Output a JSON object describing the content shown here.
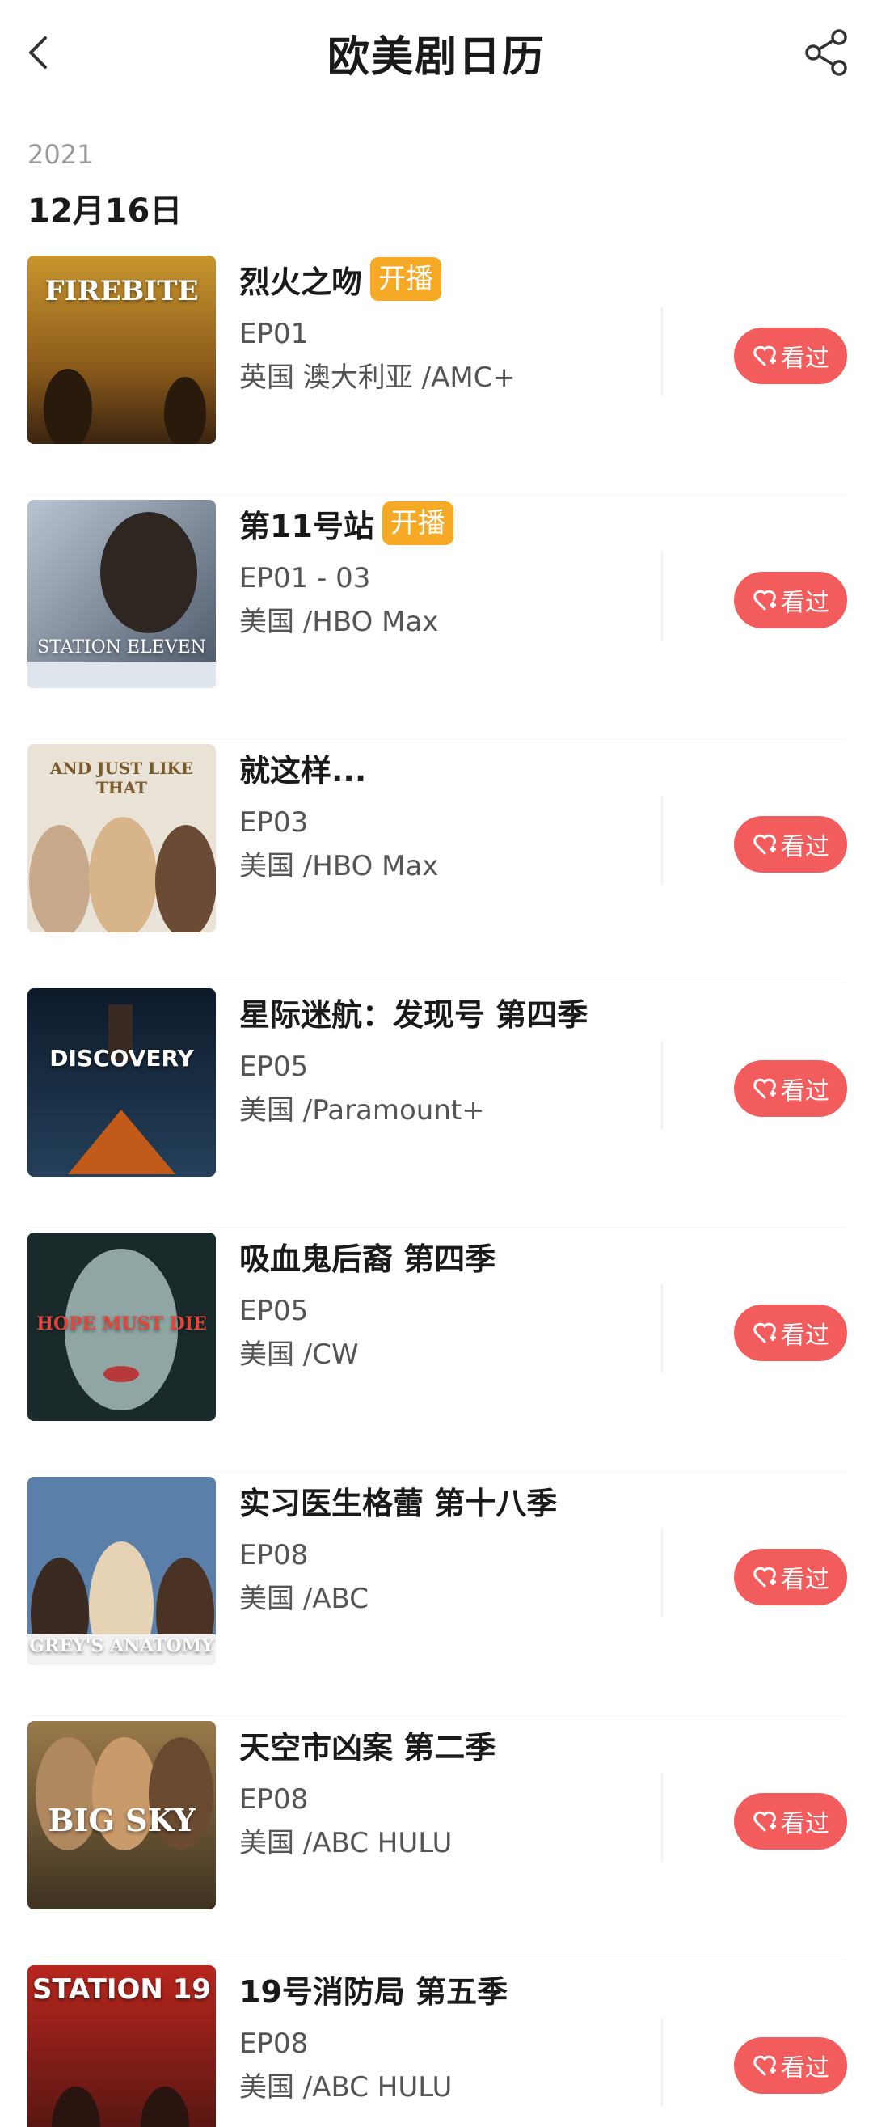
{
  "header": {
    "title": "欧美剧日历",
    "back_icon": "chevron-left-icon",
    "share_icon": "share-icon"
  },
  "section": {
    "year": "2021",
    "date": "12月16日"
  },
  "colors": {
    "badge": "#f6a924",
    "watched_button": "#f25c5c"
  },
  "shows": [
    {
      "name": "烈火之吻",
      "badge": "开播",
      "episode": "EP01",
      "region": "英国 澳大利亚 /AMC+",
      "poster_text": "FIREBITE",
      "action": "看过"
    },
    {
      "name": "第11号站",
      "badge": "开播",
      "episode": "EP01 - 03",
      "region": "美国 /HBO Max",
      "poster_text": "STATION ELEVEN",
      "action": "看过"
    },
    {
      "name": "就这样...",
      "badge": "",
      "episode": "EP03",
      "region": "美国 /HBO Max",
      "poster_text": "AND JUST LIKE THAT",
      "action": "看过"
    },
    {
      "name": "星际迷航：发现号 第四季",
      "badge": "",
      "episode": "EP05",
      "region": "美国 /Paramount+",
      "poster_text": "DISCOVERY",
      "action": "看过"
    },
    {
      "name": "吸血鬼后裔 第四季",
      "badge": "",
      "episode": "EP05",
      "region": "美国 /CW",
      "poster_text": "HOPE MUST DIE",
      "action": "看过"
    },
    {
      "name": "实习医生格蕾 第十八季",
      "badge": "",
      "episode": "EP08",
      "region": "美国 /ABC",
      "poster_text": "GREY'S ANATOMY",
      "action": "看过"
    },
    {
      "name": "天空市凶案 第二季",
      "badge": "",
      "episode": "EP08",
      "region": "美国 /ABC HULU",
      "poster_text": "BIG SKY",
      "action": "看过"
    },
    {
      "name": "19号消防局 第五季",
      "badge": "",
      "episode": "EP08",
      "region": "美国 /ABC HULU",
      "poster_text": "STATION 19",
      "action": "看过"
    }
  ]
}
